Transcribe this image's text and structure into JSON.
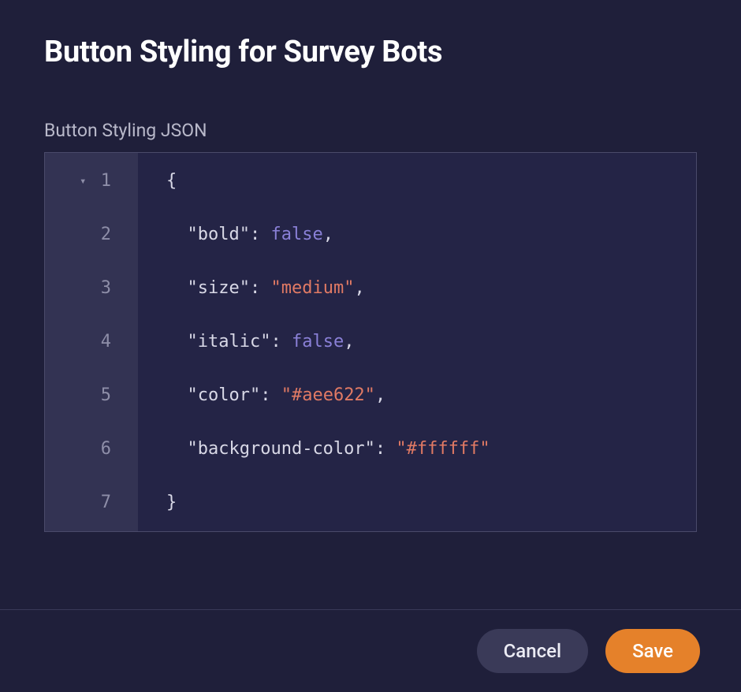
{
  "dialog": {
    "title": "Button Styling for Survey Bots"
  },
  "field": {
    "label": "Button Styling JSON"
  },
  "editor": {
    "line_numbers": [
      "1",
      "2",
      "3",
      "4",
      "5",
      "6",
      "7"
    ],
    "lines": [
      {
        "indent": "",
        "tokens": [
          {
            "t": "{",
            "c": "punc"
          }
        ]
      },
      {
        "indent": "  ",
        "tokens": [
          {
            "t": "\"bold\"",
            "c": "key"
          },
          {
            "t": ": ",
            "c": "punc"
          },
          {
            "t": "false",
            "c": "bool"
          },
          {
            "t": ",",
            "c": "punc"
          }
        ]
      },
      {
        "indent": "  ",
        "tokens": [
          {
            "t": "\"size\"",
            "c": "key"
          },
          {
            "t": ": ",
            "c": "punc"
          },
          {
            "t": "\"medium\"",
            "c": "str"
          },
          {
            "t": ",",
            "c": "punc"
          }
        ]
      },
      {
        "indent": "  ",
        "tokens": [
          {
            "t": "\"italic\"",
            "c": "key"
          },
          {
            "t": ": ",
            "c": "punc"
          },
          {
            "t": "false",
            "c": "bool"
          },
          {
            "t": ",",
            "c": "punc"
          }
        ]
      },
      {
        "indent": "  ",
        "tokens": [
          {
            "t": "\"color\"",
            "c": "key"
          },
          {
            "t": ": ",
            "c": "punc"
          },
          {
            "t": "\"#aee622\"",
            "c": "str"
          },
          {
            "t": ",",
            "c": "punc"
          }
        ]
      },
      {
        "indent": "  ",
        "tokens": [
          {
            "t": "\"background-color\"",
            "c": "key"
          },
          {
            "t": ": ",
            "c": "punc"
          },
          {
            "t": "\"#ffffff\"",
            "c": "str"
          }
        ]
      },
      {
        "indent": "",
        "tokens": [
          {
            "t": "}",
            "c": "punc"
          }
        ]
      }
    ],
    "json_value": {
      "bold": false,
      "size": "medium",
      "italic": false,
      "color": "#aee622",
      "background-color": "#ffffff"
    }
  },
  "footer": {
    "cancel_label": "Cancel",
    "save_label": "Save"
  },
  "icons": {
    "fold_caret": "▾"
  }
}
